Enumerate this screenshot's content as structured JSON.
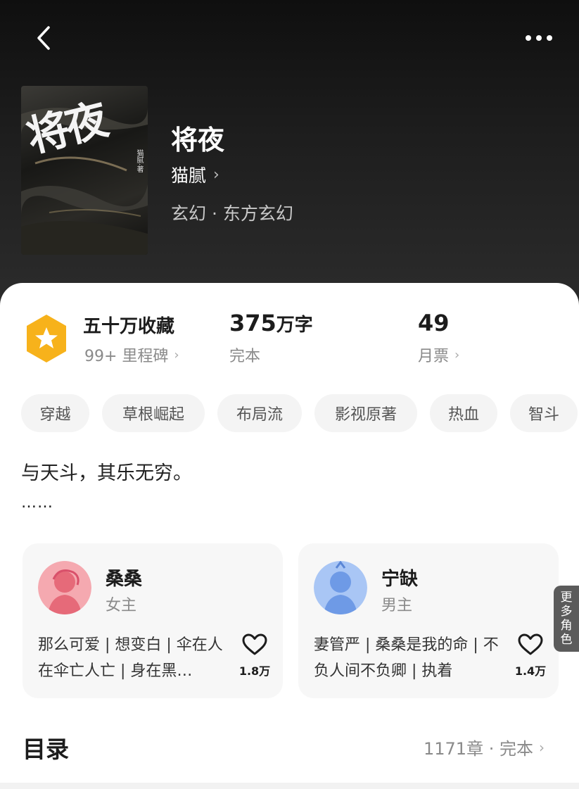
{
  "nav": {
    "back_icon": "chevron-left-icon",
    "more_icon": "more-dots-icon"
  },
  "book": {
    "cover_title": "将夜",
    "cover_subtitle": "猫腻·著",
    "title": "将夜",
    "author": "猫腻",
    "genre": "玄幻 · 东方玄幻"
  },
  "stats": {
    "collect": {
      "label": "五十万收藏",
      "sub": "99+ 里程碑"
    },
    "words": {
      "value": "375",
      "unit": "万字",
      "sub": "完本"
    },
    "votes": {
      "value": "49",
      "sub": "月票"
    }
  },
  "tags": [
    "穿越",
    "草根崛起",
    "布局流",
    "影视原著",
    "热血",
    "智斗"
  ],
  "intro": {
    "text": "与天斗，其乐无穷。",
    "ellipsis": "……"
  },
  "characters": [
    {
      "name": "桑桑",
      "role": "女主",
      "desc": "那么可爱 | 想变白 | 伞在人在伞亡人亡 | 身在黑…",
      "likes": "1.8万",
      "avatar_color": "#f08a95"
    },
    {
      "name": "宁缺",
      "role": "男主",
      "desc": "妻管严 | 桑桑是我的命 | 不负人间不负卿 | 执着",
      "likes": "1.4万",
      "avatar_color": "#8bb3f0"
    }
  ],
  "more_roles": "更多角色",
  "toc": {
    "title": "目录",
    "meta": "1171章 · 完本"
  },
  "colors": {
    "badge": "#f7b21b",
    "sheet": "#ffffff",
    "header_bg": "#1b1b1b"
  }
}
